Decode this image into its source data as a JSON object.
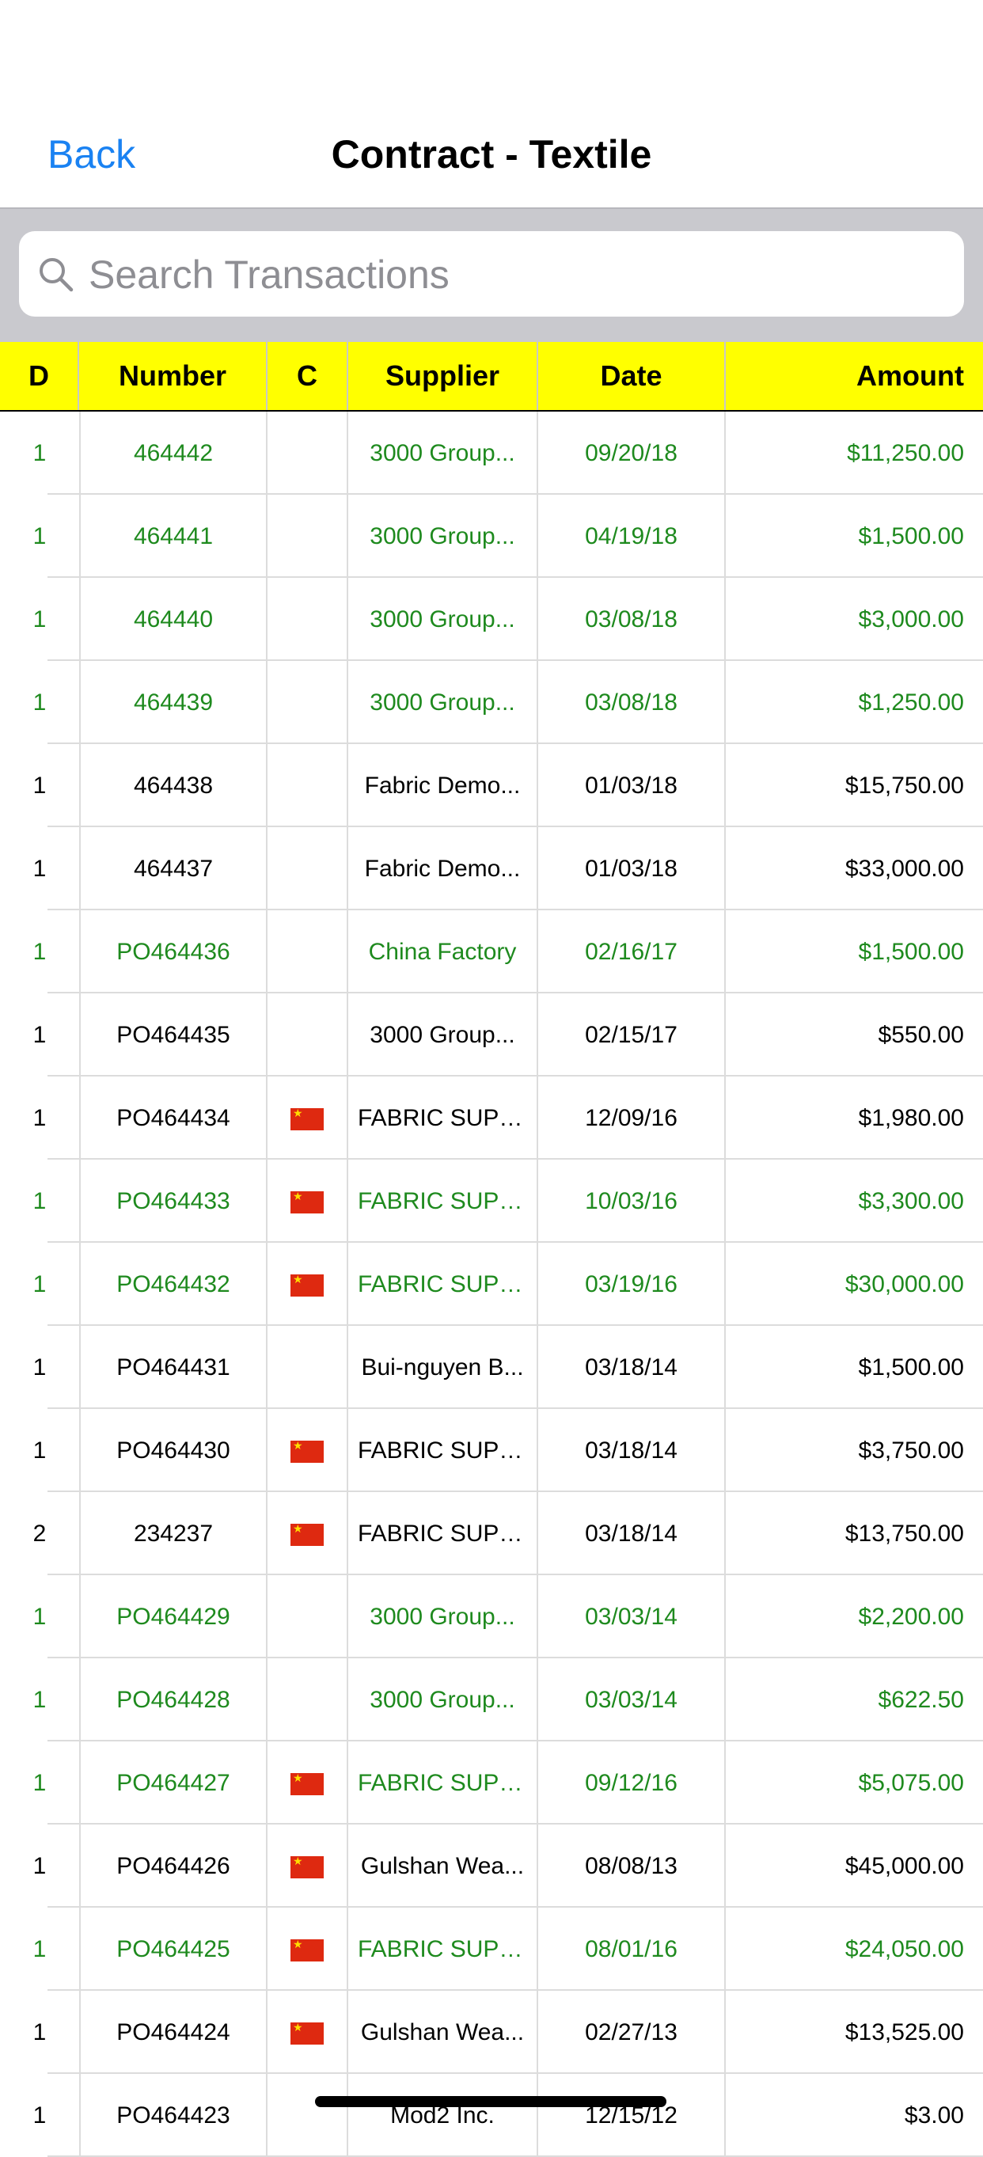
{
  "nav": {
    "back_label": "Back",
    "title": "Contract - Textile"
  },
  "search": {
    "placeholder": "Search Transactions",
    "value": ""
  },
  "colors": {
    "green": "#1e8a1e",
    "black": "#000000",
    "header_bg": "#ffff00",
    "accent": "#1a82f2"
  },
  "table": {
    "headers": {
      "d": "D",
      "number": "Number",
      "c": "C",
      "supplier": "Supplier",
      "date": "Date",
      "amount": "Amount"
    },
    "rows": [
      {
        "d": "1",
        "number": "464442",
        "flag": false,
        "supplier": "3000 Group...",
        "date": "09/20/18",
        "amount": "$11,250.00",
        "color": "green"
      },
      {
        "d": "1",
        "number": "464441",
        "flag": false,
        "supplier": "3000 Group...",
        "date": "04/19/18",
        "amount": "$1,500.00",
        "color": "green"
      },
      {
        "d": "1",
        "number": "464440",
        "flag": false,
        "supplier": "3000 Group...",
        "date": "03/08/18",
        "amount": "$3,000.00",
        "color": "green"
      },
      {
        "d": "1",
        "number": "464439",
        "flag": false,
        "supplier": "3000 Group...",
        "date": "03/08/18",
        "amount": "$1,250.00",
        "color": "green"
      },
      {
        "d": "1",
        "number": "464438",
        "flag": false,
        "supplier": "Fabric Demo...",
        "date": "01/03/18",
        "amount": "$15,750.00",
        "color": "black"
      },
      {
        "d": "1",
        "number": "464437",
        "flag": false,
        "supplier": "Fabric Demo...",
        "date": "01/03/18",
        "amount": "$33,000.00",
        "color": "black"
      },
      {
        "d": "1",
        "number": "PO464436",
        "flag": false,
        "supplier": "China Factory",
        "date": "02/16/17",
        "amount": "$1,500.00",
        "color": "green"
      },
      {
        "d": "1",
        "number": "PO464435",
        "flag": false,
        "supplier": "3000 Group...",
        "date": "02/15/17",
        "amount": "$550.00",
        "color": "black"
      },
      {
        "d": "1",
        "number": "PO464434",
        "flag": true,
        "supplier": "FABRIC SUPP...",
        "date": "12/09/16",
        "amount": "$1,980.00",
        "color": "black"
      },
      {
        "d": "1",
        "number": "PO464433",
        "flag": true,
        "supplier": "FABRIC SUPP...",
        "date": "10/03/16",
        "amount": "$3,300.00",
        "color": "green"
      },
      {
        "d": "1",
        "number": "PO464432",
        "flag": true,
        "supplier": "FABRIC SUPP...",
        "date": "03/19/16",
        "amount": "$30,000.00",
        "color": "green"
      },
      {
        "d": "1",
        "number": "PO464431",
        "flag": false,
        "supplier": "Bui-nguyen B...",
        "date": "03/18/14",
        "amount": "$1,500.00",
        "color": "black"
      },
      {
        "d": "1",
        "number": "PO464430",
        "flag": true,
        "supplier": "FABRIC SUPP...",
        "date": "03/18/14",
        "amount": "$3,750.00",
        "color": "black"
      },
      {
        "d": "2",
        "number": "234237",
        "flag": true,
        "supplier": "FABRIC SUPP...",
        "date": "03/18/14",
        "amount": "$13,750.00",
        "color": "black"
      },
      {
        "d": "1",
        "number": "PO464429",
        "flag": false,
        "supplier": "3000 Group...",
        "date": "03/03/14",
        "amount": "$2,200.00",
        "color": "green"
      },
      {
        "d": "1",
        "number": "PO464428",
        "flag": false,
        "supplier": "3000 Group...",
        "date": "03/03/14",
        "amount": "$622.50",
        "color": "green"
      },
      {
        "d": "1",
        "number": "PO464427",
        "flag": true,
        "supplier": "FABRIC SUPP...",
        "date": "09/12/16",
        "amount": "$5,075.00",
        "color": "green"
      },
      {
        "d": "1",
        "number": "PO464426",
        "flag": true,
        "supplier": "Gulshan Wea...",
        "date": "08/08/13",
        "amount": "$45,000.00",
        "color": "black"
      },
      {
        "d": "1",
        "number": "PO464425",
        "flag": true,
        "supplier": "FABRIC SUPP...",
        "date": "08/01/16",
        "amount": "$24,050.00",
        "color": "green"
      },
      {
        "d": "1",
        "number": "PO464424",
        "flag": true,
        "supplier": "Gulshan Wea...",
        "date": "02/27/13",
        "amount": "$13,525.00",
        "color": "black"
      },
      {
        "d": "1",
        "number": "PO464423",
        "flag": false,
        "supplier": "Mod2 Inc.",
        "date": "12/15/12",
        "amount": "$3.00",
        "color": "black"
      }
    ]
  }
}
